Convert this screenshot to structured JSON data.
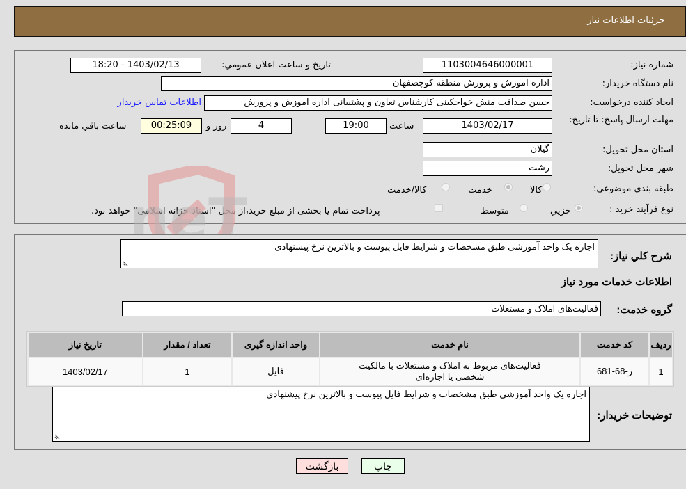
{
  "header": {
    "title": "جزئیات اطلاعات نیاز"
  },
  "form": {
    "need_number": {
      "label": "شماره نیاز:",
      "value": "1103004646000001"
    },
    "announce": {
      "label": "تاریخ و ساعت اعلان عمومي:",
      "value": "1403/02/13 - 18:20"
    },
    "buyer_org": {
      "label": "نام دستگاه خریدار:",
      "value": "اداره اموزش و پرورش منطقه کوچصفهان"
    },
    "requester": {
      "label": "ایجاد کننده درخواست:",
      "value": "حسن صداقت منش خواجکینی کارشناس تعاون و پشتیبانی اداره اموزش و پرورش",
      "contact_link": "اطلاعات تماس خریدار"
    },
    "deadline": {
      "label": "مهلت ارسال پاسخ: تا تاریخ:",
      "date": "1403/02/17",
      "time_label": "ساعت",
      "time": "19:00",
      "days": "4",
      "days_label": "روز و",
      "remaining": "00:25:09",
      "remaining_label": "ساعت باقي مانده"
    },
    "province": {
      "label": "استان محل تحویل:",
      "value": "گیلان"
    },
    "city": {
      "label": "شهر محل تحویل:",
      "value": "رشت"
    },
    "category": {
      "label": "طبقه بندی موضوعی:",
      "options": [
        {
          "label": "کالا",
          "checked": false
        },
        {
          "label": "خدمت",
          "checked": true
        },
        {
          "label": "کالا/خدمت",
          "checked": false
        }
      ]
    },
    "process": {
      "label": "نوع فرآیند خرید :",
      "options": [
        {
          "label": "جزيي",
          "checked": true
        },
        {
          "label": "متوسط",
          "checked": false
        }
      ],
      "treasury_note": "پرداخت تمام یا بخشی از مبلغ خرید،از محل \"اسناد خزانه اسلامی\" خواهد بود."
    }
  },
  "details": {
    "description_label": "شرح کلي نياز:",
    "description": "اجاره یک واحد آموزشی طبق مشخصات  و شرایط فایل پیوست و بالاترین  نرخ  پیشنهادی",
    "services_heading": "اطلاعات خدمات مورد نیاز",
    "service_group_label": "گروه خدمت:",
    "service_group": "فعالیت‌های  املاک و مستغلات",
    "table": {
      "headers": [
        "ردیف",
        "کد خدمت",
        "نام خدمت",
        "واحد اندازه گیری",
        "تعداد / مقدار",
        "تاریخ نیاز"
      ],
      "rows": [
        [
          "1",
          "ر-68-681",
          "فعالیت‌های مربوط به املاک و مستغلات با مالکیت شخصی یا اجاره‌ای",
          "فایل",
          "1",
          "1403/02/17"
        ]
      ]
    },
    "buyer_notes_label": "توضیحات خریدار:",
    "buyer_notes": "اجاره یک واحد آموزشی طبق مشخصات  و شرایط فایل پیوست و بالاترین  نرخ  پیشنهادی"
  },
  "buttons": {
    "print": "چاپ",
    "back": "بازگشت"
  },
  "colors": {
    "header_bg": "#8f6e42",
    "print_bg": "#eaffea",
    "back_bg": "#ffdede",
    "link": "#1a1aff",
    "remaining_bg": "#ffffe0"
  },
  "watermark": {
    "text": "AriaTender.neT"
  }
}
